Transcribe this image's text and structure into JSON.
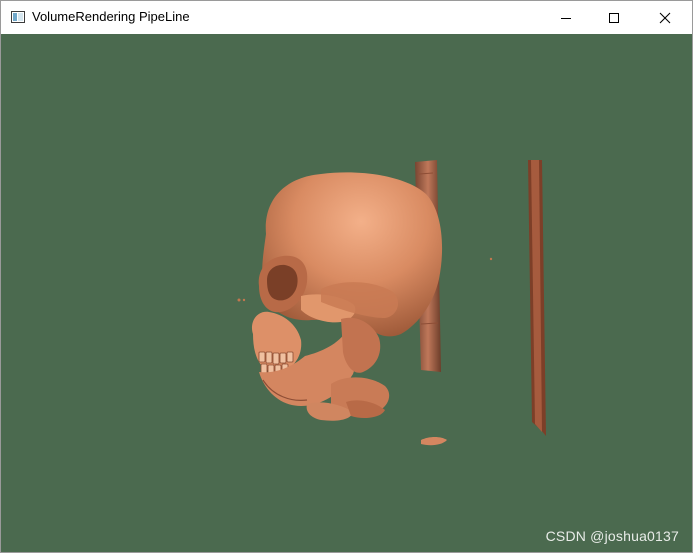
{
  "window": {
    "title": "VolumeRendering PipeLine",
    "app_icon": "vtk-window-icon"
  },
  "controls": {
    "minimize_icon": "minimize-icon",
    "maximize_icon": "maximize-icon",
    "close_icon": "close-icon"
  },
  "viewport": {
    "background_color": "#4b6a4f",
    "render_color": "#d98b62",
    "content": "skull-volume-render"
  },
  "watermark": {
    "text": "CSDN @joshua0137"
  }
}
